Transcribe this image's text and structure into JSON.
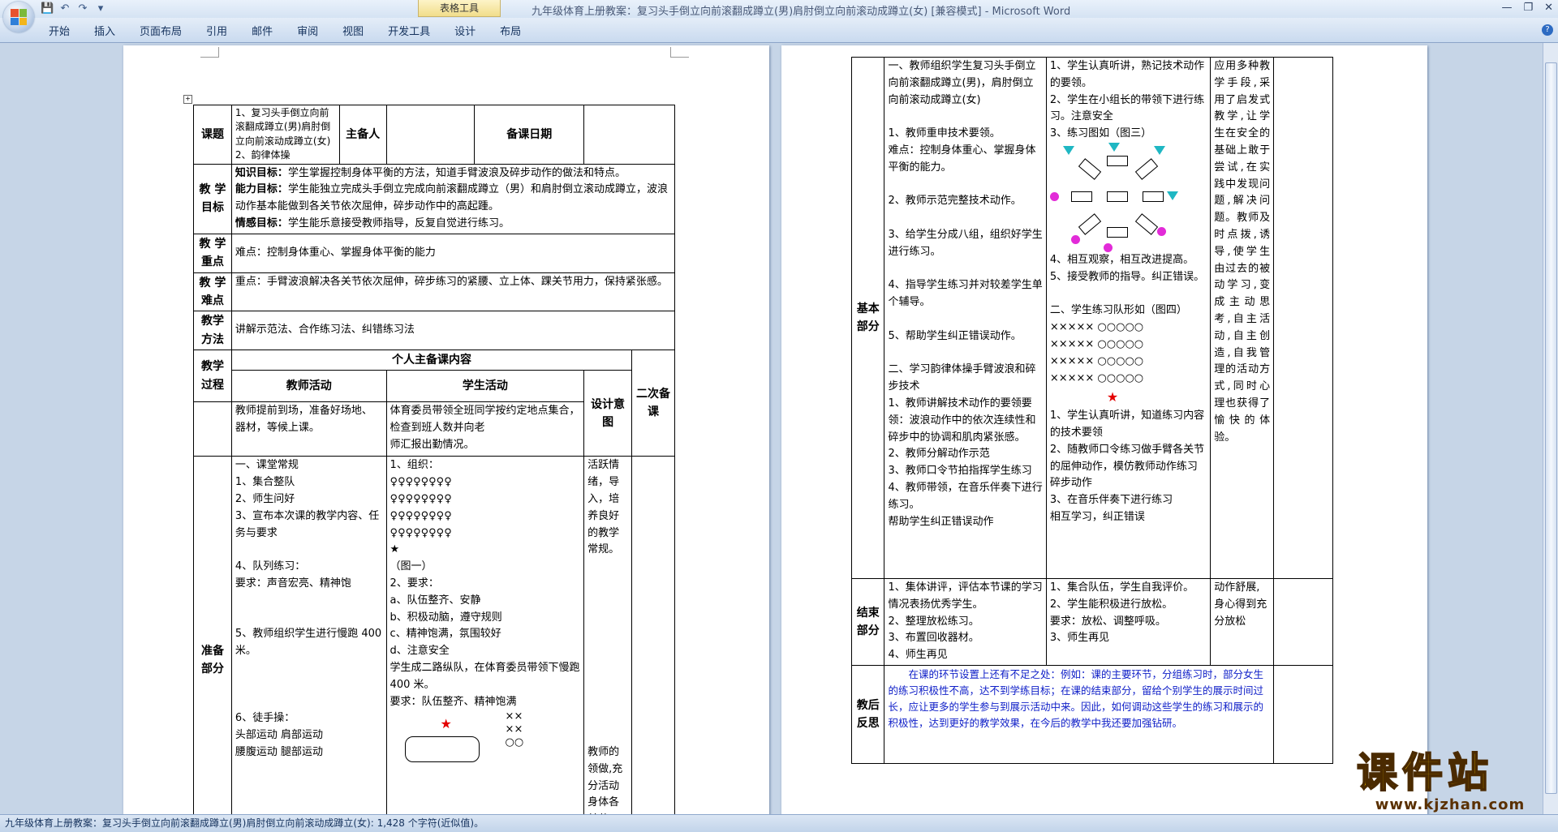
{
  "window": {
    "title": "九年级体育上册教案：复习头手倒立向前滚翻成蹲立(男)肩肘倒立向前滚动成蹲立(女) [兼容模式] - Microsoft Word",
    "context_tab": "表格工具"
  },
  "ribbon": {
    "tabs": [
      "开始",
      "插入",
      "页面布局",
      "引用",
      "邮件",
      "审阅",
      "视图",
      "开发工具",
      "设计",
      "布局"
    ]
  },
  "page1": {
    "r1": {
      "label": "课题",
      "topic": "1、复习头手倒立向前滚翻成蹲立(男)肩肘倒立向前滚动成蹲立(女)\n2、韵律体操",
      "prep_label": "主备人",
      "date_label": "备课日期"
    },
    "r2": {
      "label": "教 学\n目标",
      "k_label": "知识目标：",
      "k_text": "学生掌握控制身体平衡的方法，知道手臂波浪及碎步动作的做法和特点。",
      "a_label": "能力目标：",
      "a_text": "学生能独立完成头手倒立完成向前滚翻成蹲立（男）和肩肘倒立滚动成蹲立，波浪动作基本能做到各关节依次屈伸，碎步动作中的高起踵。",
      "e_label": "情感目标：",
      "e_text": "学生能乐意接受教师指导，反复自觉进行练习。"
    },
    "r3": {
      "label": "教 学\n重点",
      "text": "难点：控制身体重心、掌握身体平衡的能力"
    },
    "r4": {
      "label": "教 学\n难点",
      "text": "重点：手臂波浪解决各关节依次屈伸，碎步练习的紧腰、立上体、踝关节用力，保持紧张感。"
    },
    "r5": {
      "label": "教学\n方法",
      "text": "讲解示范法、合作练习法、纠错练习法"
    },
    "r6": {
      "label": "教学\n过程",
      "content_head": "个人主备课内容",
      "teacher_head": "教师活动",
      "student_head": "学生活动",
      "design_head": "设计意图",
      "second_head": "二次备课"
    },
    "r7": {
      "teacher": "教师提前到场，准备好场地、器材，等候上课。",
      "student": "体育委员带领全班同学按约定地点集合，检查到班人数并向老\n师汇报出勤情况。"
    },
    "r8": {
      "label": "准备\n部分",
      "teacher": "一、课堂常规\n1、集合整队\n2、师生问好\n3、宣布本次课的教学内容、任务与要求\n\n4、队列练习：\n要求：声音宏亮、精神饱\n\n\n5、教师组织学生进行慢跑 400 米。\n\n\n\n6、徒手操：\n   头部运动   肩部运动\n   腰腹运动   腿部运动",
      "student": "1、组织：\n      ♀♀♀♀♀♀♀♀\n      ♀♀♀♀♀♀♀♀\n      ♀♀♀♀♀♀♀♀\n      ♀♀♀♀♀♀♀♀\n            ★\n          （图一）\n2、要求：\na、队伍整齐、安静\nb、积极动脑，遵守规则\nc、精神饱满，氛围较好\nd、注意安全\n学生成二路纵队，在体育委员带领下慢跑 400 米。\n要求：队伍整齐、精神饱满",
      "design": "活跃情绪，导入，培养良好的教学常规。\n\n\n\n\n\n\n\n\n\n\n\n教师的领做,充分活动身体各关节。防止运动损伤",
      "fig_cross1": "××",
      "fig_cross2": "××",
      "fig_circle": "○○"
    }
  },
  "page2": {
    "basic": {
      "label": "基本\n部分",
      "teacher": "一、教师组织学生复习头手倒立向前滚翻成蹲立(男)，肩肘倒立向前滚动成蹲立(女)\n\n1、教师重申技术要领。\n难点：控制身体重心、掌握身体平衡的能力。\n\n2、教师示范完整技术动作。\n\n3、给学生分成八组，组织好学生进行练习。\n\n4、指导学生练习并对较差学生单个辅导。\n\n5、帮助学生纠正错误动作。\n\n二、学习韵律体操手臂波浪和碎步技术\n1、教师讲解技术动作的要领要领：波浪动作中的依次连续性和碎步中的协调和肌肉紧张感。\n2、教师分解动作示范\n3、教师口令节拍指挥学生练习\n4、教师带领，在音乐伴奏下进行练习。\n帮助学生纠正错误动作",
      "student_a": "1、学生认真听讲，熟记技术动作的要领。\n2、学生在小组长的带领下进行练习。注意安全\n3、练习图如（图三）",
      "student_b": "4、相互观察，相互改进提高。\n5、接受教师的指导。纠正错误。\n\n二、学生练习队形如（图四）\n×××××  ○○○○○\n×××××  ○○○○○\n×××××  ○○○○○\n×××××  ○○○○○",
      "student_c": "1、学生认真听讲，知道练习内容的技术要领\n2、随教师口令练习做手臂各关节的屈伸动作，模仿教师动作练习碎步动作\n3、在音乐伴奏下进行练习\n相互学习，纠正错误",
      "design": "应用多种教学手段,采用了启发式教学,让学生在安全的基础上敢于尝试,在实践中发现问题,解决问题。教师及时点拨,诱导,使学生由过去的被动学习,变成主动思考,自主活动,自主创造,自我管理的活动方式,同时心理也获得了愉快的体验。"
    },
    "end": {
      "label": "结束\n部分",
      "teacher": "1、集体讲评，评估本节课的学习情况表扬优秀学生。\n2、整理放松练习。\n3、布置回收器材。\n4、师生再见",
      "student": "1、集合队伍，学生自我评价。\n2、学生能积极进行放松。\n要求：放松、调整呼吸。\n3、师生再见",
      "design": "动作舒展,身心得到充分放松"
    },
    "reflect": {
      "label": "教后\n反思",
      "text": "在课的环节设置上还有不足之处：例如：课的主要环节，分组练习时，部分女生的练习积极性不高，达不到学练目标；在课的结束部分，留给个别学生的展示时间过长，应让更多的学生参与到展示活动中来。因此，如何调动这些学生的练习和展示的积极性，达到更好的教学效果，在今后的教学中我还要加强钻研。"
    }
  },
  "status": {
    "text": "九年级体育上册教案：复习头手倒立向前滚翻成蹲立(男)肩肘倒立向前滚动成蹲立(女): 1,428 个字符(近似值)。"
  },
  "watermark": {
    "main": "课件站",
    "url": "www.kjzhan.com"
  },
  "colors": {
    "ribbon": "#c9daef",
    "workspace": "#c6d5e7",
    "reflection_text": "#1020c8",
    "triangle": "#1fb7c3",
    "dot": "#e22bd8",
    "star": "#e40000"
  }
}
